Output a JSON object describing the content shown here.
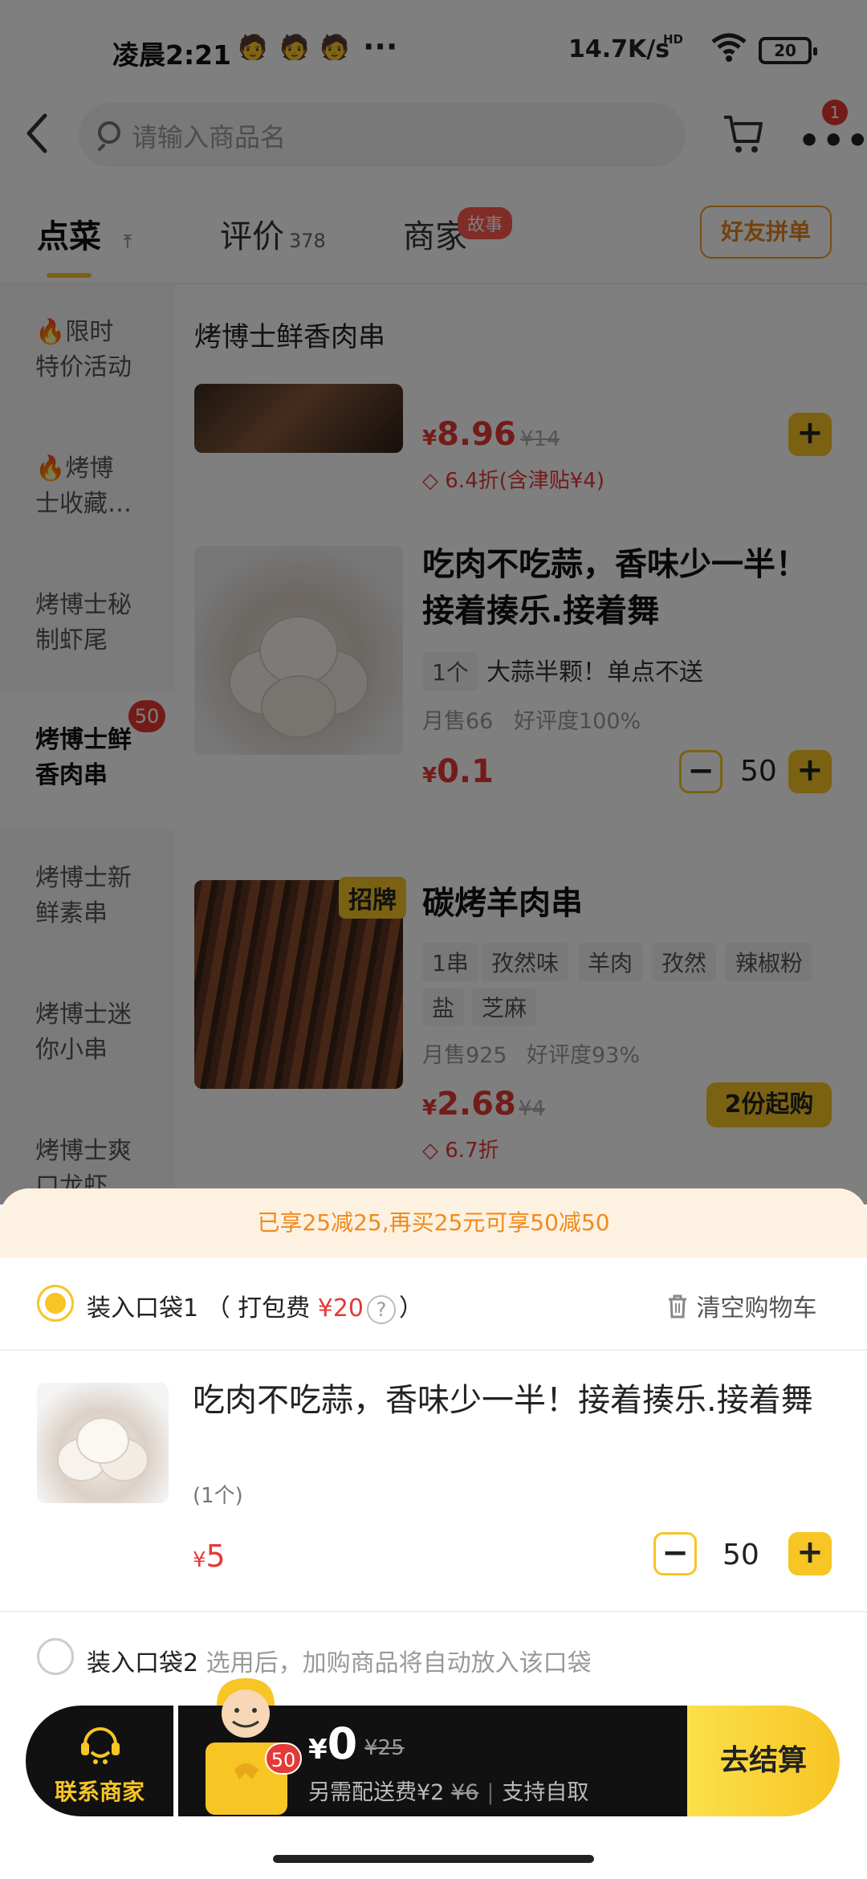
{
  "status_bar": {
    "time": "凌晨2:21",
    "speed": "14.7K/s",
    "network": "HD",
    "battery": "20",
    "overflow": "···"
  },
  "header": {
    "search_placeholder": "请输入商品名",
    "cart_badge": "1"
  },
  "tabs": [
    {
      "label": "点菜",
      "count": ""
    },
    {
      "label": "评价",
      "count": "378"
    },
    {
      "label": "商家",
      "count": ""
    }
  ],
  "story_badge": "故事",
  "group_order_label": "好友拼单",
  "sidebar": {
    "items": [
      {
        "line1": "🔥限时",
        "line2": "特价活动"
      },
      {
        "line1": "🔥烤博",
        "line2": "士收藏…"
      },
      {
        "line1": "烤博士秘",
        "line2": "制虾尾"
      },
      {
        "line1": "烤博士鲜",
        "line2": "香肉串"
      },
      {
        "line1": "烤博士新",
        "line2": "鲜素串"
      },
      {
        "line1": "烤博士迷",
        "line2": "你小串"
      },
      {
        "line1": "烤博士爽",
        "line2": "口龙虾"
      }
    ],
    "active_badge": "50"
  },
  "section_title": "烤博士鲜香肉串",
  "products": [
    {
      "price_symbol": "¥",
      "price": "8.96",
      "old_price": "¥14",
      "discount": "6.4折(含津贴¥4)"
    },
    {
      "name_line1": "吃肉不吃蒜，香味少一半！",
      "name_line2": "接着揍乐.接着舞",
      "tags": [
        "1个",
        "大蒜半颗！单点不送"
      ],
      "monthly": "月售66",
      "rating": "好评度100%",
      "price_symbol": "¥",
      "price": "0.1",
      "qty": "50"
    },
    {
      "badge": "招牌",
      "name": "碳烤羊肉串",
      "tags_row1": [
        "1串",
        "孜然味",
        "羊肉",
        "孜然",
        "辣椒粉"
      ],
      "tags_row2": [
        "盐",
        "芝麻"
      ],
      "monthly": "月售925",
      "rating": "好评度93%",
      "price_symbol": "¥",
      "price": "2.68",
      "old_price": "¥4",
      "discount": "6.7折",
      "min_buy": "2份起购"
    }
  ],
  "cart_sheet": {
    "promo": "已享25减25,再买25元可享50减50",
    "bag1": {
      "label": "装入口袋1",
      "pack_prefix": "（ 打包费",
      "pack_fee": "¥20",
      "help": "?",
      "suffix": "）"
    },
    "clear_label": "清空购物车",
    "item": {
      "name": "吃肉不吃蒜，香味少一半！接着揍乐.接着舞",
      "spec": "(1个)",
      "price_symbol": "¥",
      "price": "5",
      "qty": "50"
    },
    "bag2": {
      "label": "装入口袋2",
      "hint": "选用后，加购商品将自动放入该口袋"
    }
  },
  "bottom_bar": {
    "contact_label": "联系商家",
    "count_badge": "50",
    "total_symbol": "¥",
    "total": "0",
    "total_old": "¥25",
    "delivery_fee": "另需配送费¥2",
    "delivery_old": "¥6",
    "self_pickup": "支持自取",
    "checkout_label": "去结算"
  },
  "colors": {
    "accent_yellow": "#f7c524",
    "price_red": "#e53935",
    "promo_orange": "#f08a1c",
    "overlay": "rgba(0,0,0,0.5)"
  }
}
